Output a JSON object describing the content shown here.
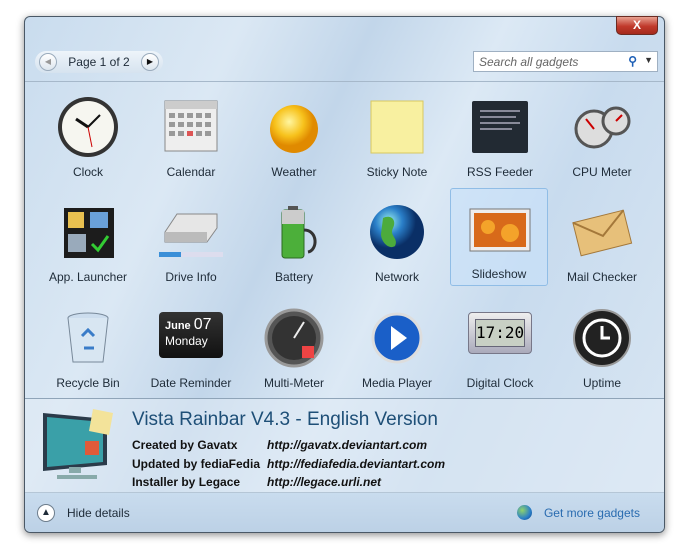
{
  "window": {
    "close_label": "X"
  },
  "pager": {
    "text": "Page 1 of 2",
    "prev": "◀",
    "next": "▶"
  },
  "search": {
    "placeholder": "Search all gadgets",
    "icon": "search-icon"
  },
  "gadgets": [
    {
      "label": "Clock"
    },
    {
      "label": "Calendar"
    },
    {
      "label": "Weather"
    },
    {
      "label": "Sticky Note"
    },
    {
      "label": "RSS Feeder"
    },
    {
      "label": "CPU Meter"
    },
    {
      "label": "App. Launcher"
    },
    {
      "label": "Drive Info"
    },
    {
      "label": "Battery"
    },
    {
      "label": "Network"
    },
    {
      "label": "Slideshow",
      "selected": true
    },
    {
      "label": "Mail Checker"
    },
    {
      "label": "Recycle Bin"
    },
    {
      "label": "Date Reminder",
      "icon_text": [
        "June",
        "07",
        "Monday"
      ]
    },
    {
      "label": "Multi-Meter"
    },
    {
      "label": "Media Player"
    },
    {
      "label": "Digital Clock",
      "icon_text": "17:20"
    },
    {
      "label": "Uptime"
    }
  ],
  "details": {
    "title": "Vista Rainbar V4.3 - English Version",
    "rows": [
      {
        "label": "Created by Gavatx",
        "url": "http://gavatx.deviantart.com"
      },
      {
        "label": "Updated by fediaFedia",
        "url": "http://fediafedia.deviantart.com"
      },
      {
        "label": "Installer by Legace",
        "url": "http://legace.urli.net"
      }
    ]
  },
  "footer": {
    "hide_details": "Hide details",
    "get_more": "Get more gadgets"
  }
}
